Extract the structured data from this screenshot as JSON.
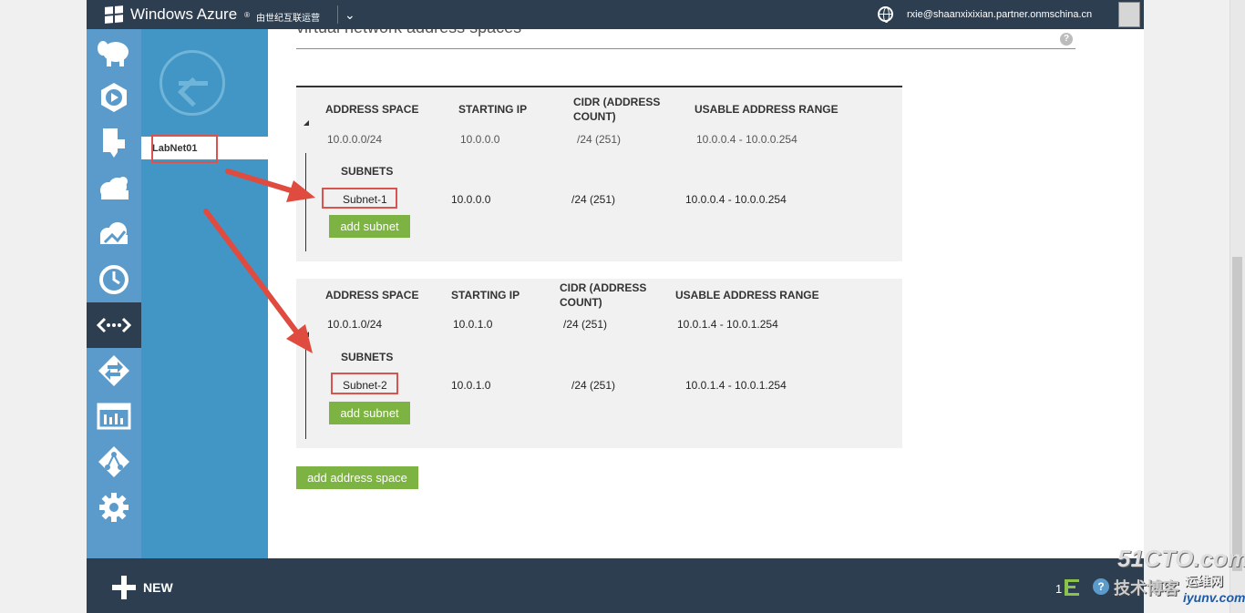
{
  "topbar": {
    "brand": "Windows Azure",
    "brand_mark": "®",
    "tenant": "由世纪互联运营",
    "user_email": "rxie@shaanxixixian.partner.onmschina.cn"
  },
  "sidebar": {
    "icons": [
      "hdinsight-icon",
      "media-services-icon",
      "mobile-services-icon",
      "cloud-services-icon",
      "storage-icon",
      "recovery-services-icon",
      "networks-icon",
      "traffic-manager-icon",
      "management-services-icon",
      "active-directory-icon",
      "settings-icon"
    ],
    "active_index": 6
  },
  "panel": {
    "network_name": "LabNet01"
  },
  "main": {
    "section_title": "virtual network address spaces",
    "headers": {
      "address_space": "ADDRESS SPACE",
      "starting_ip": "STARTING IP",
      "cidr_line1": "CIDR (ADDRESS",
      "cidr_line2": "COUNT)",
      "usable_range": "USABLE ADDRESS RANGE",
      "subnets": "SUBNETS"
    },
    "address_spaces": [
      {
        "address_space": "10.0.0.0/24",
        "starting_ip": "10.0.0.0",
        "cidr": "/24 (251)",
        "usable_range": "10.0.0.4 - 10.0.0.254",
        "subnet": {
          "name": "Subnet-1",
          "starting_ip": "10.0.0.0",
          "cidr": "/24 (251)",
          "usable_range": "10.0.0.4 - 10.0.0.254"
        }
      },
      {
        "address_space": "10.0.1.0/24",
        "starting_ip": "10.0.1.0",
        "cidr": "/24 (251)",
        "usable_range": "10.0.1.4 - 10.0.1.254",
        "subnet": {
          "name": "Subnet-2",
          "starting_ip": "10.0.1.0",
          "cidr": "/24 (251)",
          "usable_range": "10.0.1.4 - 10.0.1.254"
        }
      }
    ],
    "add_subnet_label": "add subnet",
    "add_address_space_label": "add address space"
  },
  "bottombar": {
    "new_label": "NEW",
    "notification_count": "1"
  },
  "watermark": {
    "line1": "51CTO.com",
    "line2": "技术博客",
    "line3": "运维网",
    "line4": "iyunv.com"
  },
  "colors": {
    "accent_blue": "#4196c6",
    "nav_dark": "#2d3e50",
    "button_green": "#7cb342",
    "annotation_red": "#d9534f"
  }
}
